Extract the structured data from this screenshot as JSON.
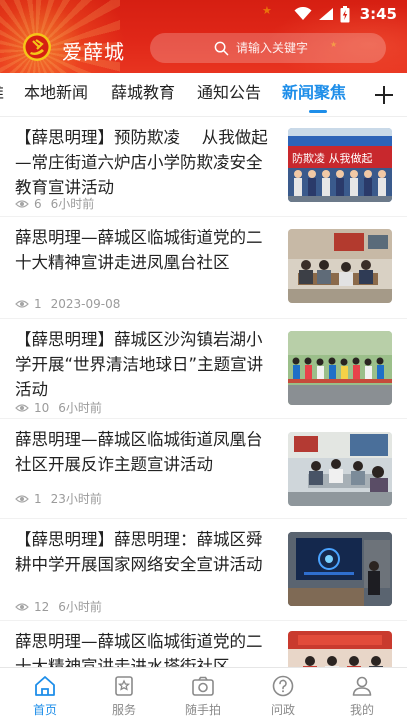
{
  "status_bar": {
    "time": "3:45"
  },
  "header": {
    "app_title": "爱薛城",
    "search_placeholder": "请输入关键字"
  },
  "tabs": [
    {
      "label": "本地新闻",
      "active": false
    },
    {
      "label": "薛城教育",
      "active": false
    },
    {
      "label": "通知公告",
      "active": false
    },
    {
      "label": "新闻聚焦",
      "active": true
    }
  ],
  "tab_partial_label": "推",
  "news": [
    {
      "title": "【薛思明理】预防欺凌　 从我做起—常庄街道六炉店小学防欺凌安全教育宣讲活动",
      "views": "6",
      "time": "6小时前",
      "image": "anti-bullying-banner-photo",
      "image_text": "防欺凌 从我做起"
    },
    {
      "title": "薛思明理—薛城区临城街道党的二十大精神宣讲走进凤凰台社区",
      "views": "1",
      "time": "2023-09-08",
      "image": "meeting-room-photo"
    },
    {
      "title": "【薛思明理】薛城区沙沟镇岩湖小学开展“世界清洁地球日”主题宣讲活动",
      "views": "10",
      "time": "6小时前",
      "image": "students-outdoor-photo"
    },
    {
      "title": "薛思明理—薛城区临城街道凤凰台社区开展反诈主题宣讲活动",
      "views": "1",
      "time": "23小时前",
      "image": "community-meeting-photo"
    },
    {
      "title": "【薛思明理】薛思明理：薛城区舜耕中学开展国家网络安全宣讲活动",
      "views": "12",
      "time": "6小时前",
      "image": "classroom-presentation-photo"
    },
    {
      "title": "薛思明理—薛城区临城街道党的二十大精神宣讲走进水塔街社区",
      "views": "",
      "time": "",
      "image": "party-meeting-photo"
    }
  ],
  "bottom_nav": [
    {
      "label": "首页",
      "icon": "home-icon",
      "active": true
    },
    {
      "label": "服务",
      "icon": "service-icon",
      "active": false
    },
    {
      "label": "随手拍",
      "icon": "camera-icon",
      "active": false
    },
    {
      "label": "问政",
      "icon": "question-icon",
      "active": false
    },
    {
      "label": "我的",
      "icon": "user-icon",
      "active": false
    }
  ],
  "colors": {
    "header_red": "#d61f12",
    "accent_blue": "#1e8ee9",
    "meta_gray": "#9b9b9b"
  }
}
